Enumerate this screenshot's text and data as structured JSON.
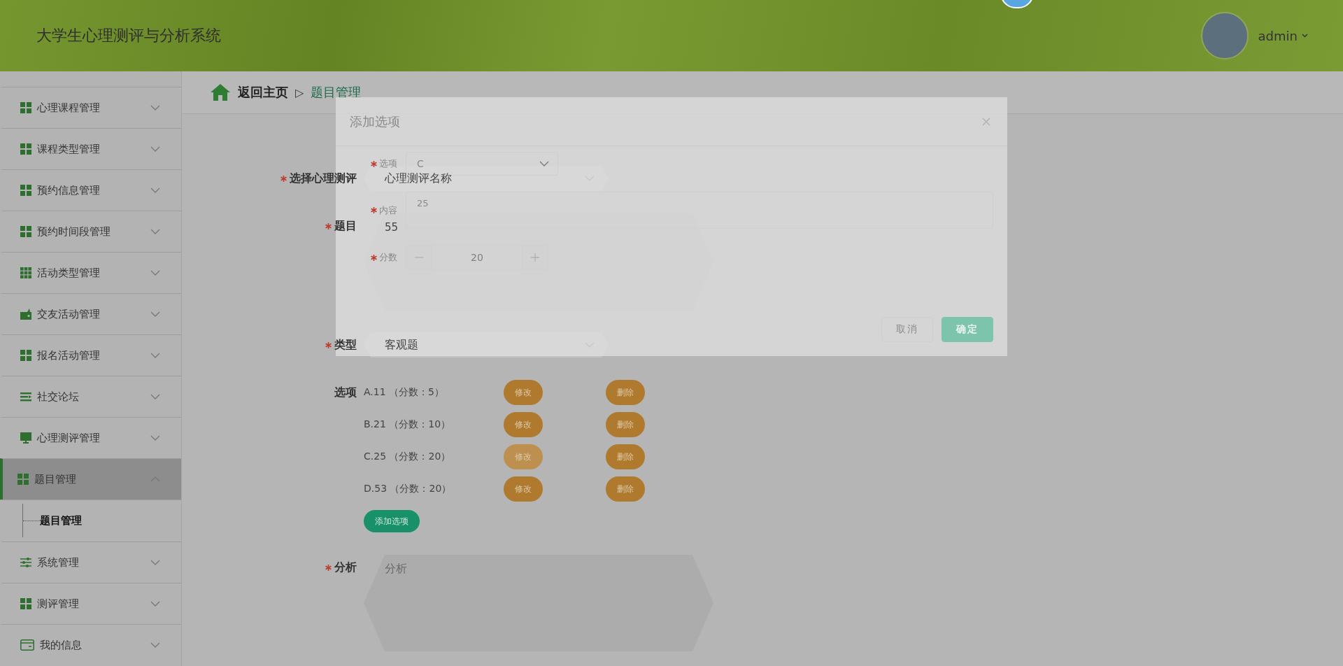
{
  "header": {
    "title": "大学生心理测评与分析系统",
    "user": "admin"
  },
  "sidebar": {
    "items": [
      {
        "label": "心理课程管理",
        "kind": "grid",
        "expanded": false,
        "selected": false
      },
      {
        "label": "课程类型管理",
        "kind": "grid",
        "expanded": false,
        "selected": false
      },
      {
        "label": "预约信息管理",
        "kind": "grid",
        "expanded": false,
        "selected": false
      },
      {
        "label": "预约时间段管理",
        "kind": "grid",
        "expanded": false,
        "selected": false
      },
      {
        "label": "活动类型管理",
        "kind": "grid9",
        "expanded": false,
        "selected": false
      },
      {
        "label": "交友活动管理",
        "kind": "wallet",
        "expanded": false,
        "selected": false
      },
      {
        "label": "报名活动管理",
        "kind": "grid",
        "expanded": false,
        "selected": false
      },
      {
        "label": "社交论坛",
        "kind": "lines",
        "expanded": false,
        "selected": false
      },
      {
        "label": "心理测评管理",
        "kind": "monitor",
        "expanded": false,
        "selected": false
      },
      {
        "label": "题目管理",
        "kind": "grid",
        "expanded": true,
        "selected": true,
        "children": [
          {
            "label": "题目管理"
          }
        ]
      },
      {
        "label": "系统管理",
        "kind": "sliders",
        "expanded": false,
        "selected": false
      },
      {
        "label": "测评管理",
        "kind": "grid",
        "expanded": false,
        "selected": false
      },
      {
        "label": "我的信息",
        "kind": "card",
        "expanded": false,
        "selected": false
      }
    ]
  },
  "breadcrumb": {
    "home": "返回主页",
    "separator": "▷",
    "current": "题目管理"
  },
  "form": {
    "fields": [
      {
        "kind": "select",
        "label": "选择心理测评",
        "required": true,
        "value": "心理测评名称"
      },
      {
        "kind": "textarea",
        "label": "题目",
        "required": true,
        "value": "55"
      },
      {
        "kind": "select",
        "label": "类型",
        "required": true,
        "value": "客观题"
      },
      {
        "kind": "options",
        "label": "选项",
        "required": false,
        "add_button": "添加选项",
        "items": [
          {
            "text": "A.11 （分数：5）",
            "edit": "修改",
            "delete": "删除",
            "hovered": false
          },
          {
            "text": "B.21 （分数：10）",
            "edit": "修改",
            "delete": "删除",
            "hovered": false
          },
          {
            "text": "C.25 （分数：20）",
            "edit": "修改",
            "delete": "删除",
            "hovered": true
          },
          {
            "text": "D.53 （分数：20）",
            "edit": "修改",
            "delete": "删除",
            "hovered": false
          }
        ]
      },
      {
        "kind": "textarea",
        "label": "分析",
        "required": true,
        "placeholder": "分析"
      }
    ]
  },
  "dialog": {
    "title": "添加选项",
    "fields": [
      {
        "kind": "select",
        "label": "选项",
        "required": true,
        "value": "C"
      },
      {
        "kind": "textarea",
        "label": "内容",
        "required": true,
        "value": "25"
      },
      {
        "kind": "number",
        "label": "分数",
        "required": true,
        "value": "20"
      }
    ],
    "buttons": [
      {
        "label": "取消",
        "kind": "default"
      },
      {
        "label": "确定",
        "kind": "primary"
      }
    ]
  }
}
